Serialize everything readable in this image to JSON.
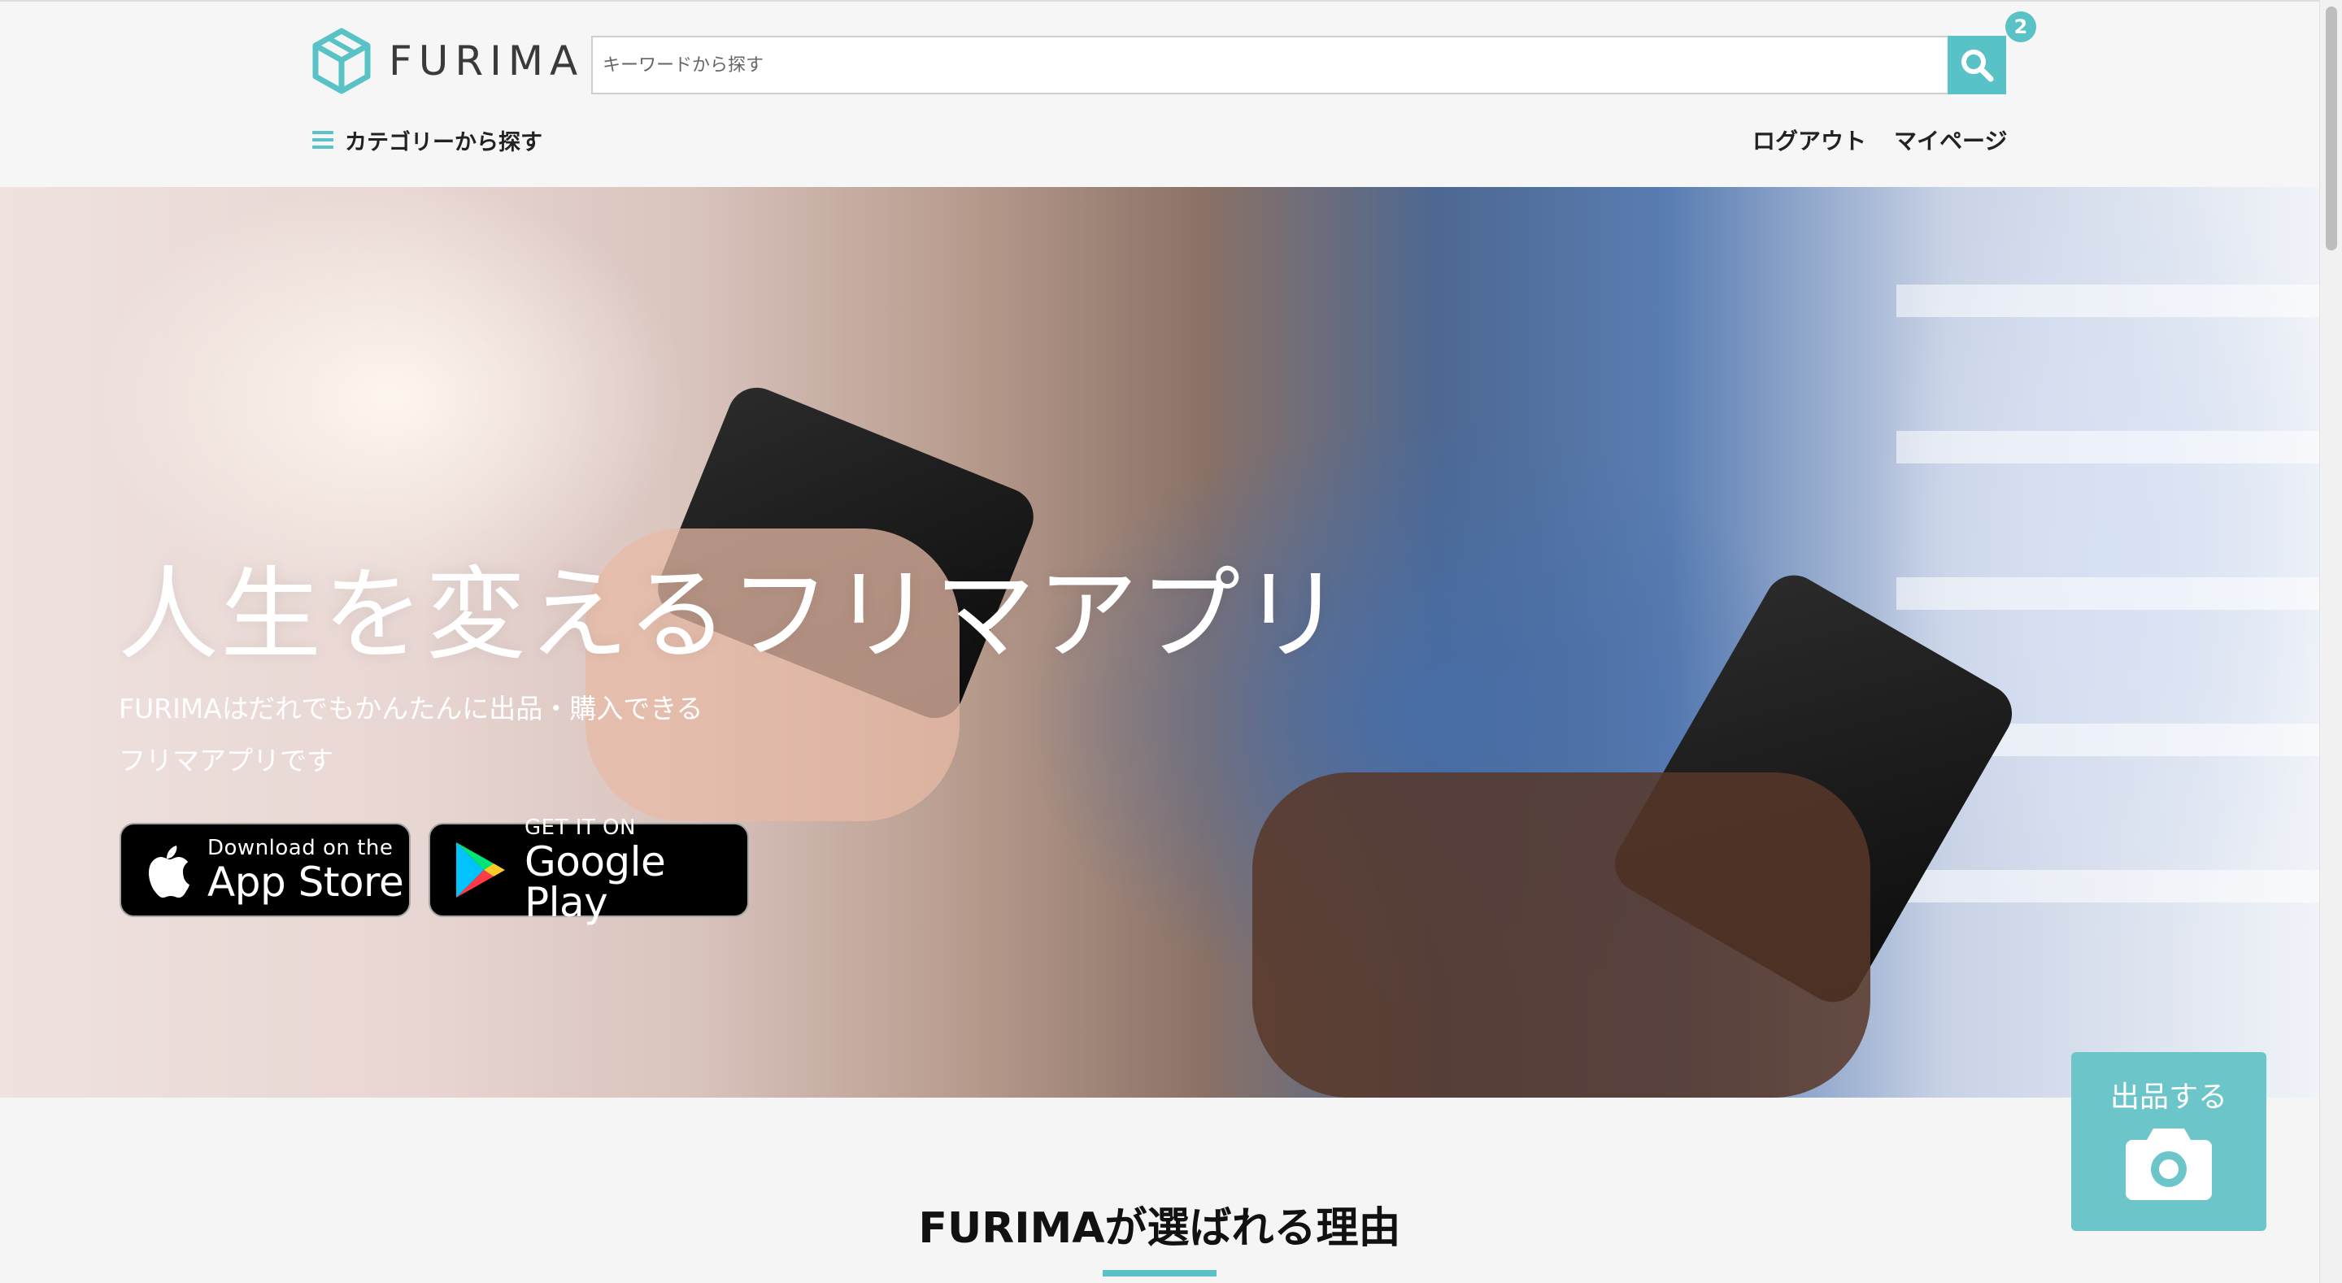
{
  "header": {
    "logo_text": "FURIMA",
    "search": {
      "placeholder": "キーワードから探す",
      "value": ""
    },
    "category_label": "カテゴリーから探す",
    "logout_label": "ログアウト",
    "mypage_label": "マイページ",
    "notification_count": "2"
  },
  "hero": {
    "title": "人生を変えるフリマアプリ",
    "subtitle_line1": "FURIMAはだれでもかんたんに出品・購入できる",
    "subtitle_line2": "フリマアプリです",
    "app_store": {
      "small": "Download on the",
      "big": "App Store"
    },
    "google_play": {
      "small": "GET IT ON",
      "big": "Google Play"
    }
  },
  "section": {
    "title": "FURIMAが選ばれる理由"
  },
  "sell_button": {
    "label": "出品する"
  },
  "colors": {
    "accent": "#58c2c6",
    "sell": "#6cc5c9"
  },
  "icons": [
    "logo-cube-icon",
    "search-icon",
    "hamburger-icon",
    "apple-icon",
    "google-play-icon",
    "camera-icon"
  ]
}
